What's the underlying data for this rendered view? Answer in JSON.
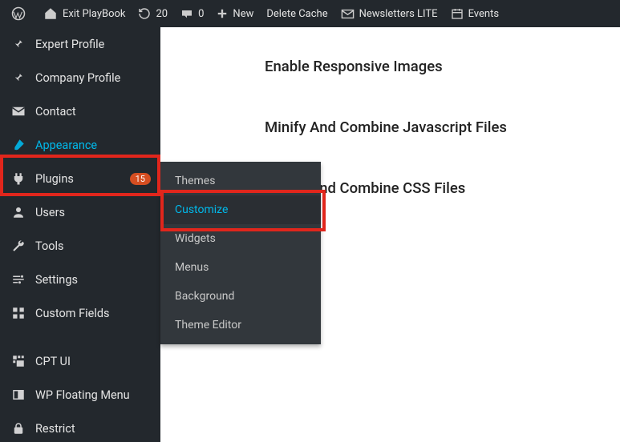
{
  "adminbar": {
    "site": "Exit PlayBook",
    "refresh": "20",
    "comments": "0",
    "new": "New",
    "delete_cache": "Delete Cache",
    "newsletters": "Newsletters LITE",
    "events": "Events",
    "plus": "+"
  },
  "sidebar": {
    "items": [
      {
        "key": "expert-profile",
        "label": "Expert Profile",
        "icon": "pin"
      },
      {
        "key": "company-profile",
        "label": "Company Profile",
        "icon": "pin"
      },
      {
        "key": "contact",
        "label": "Contact",
        "icon": "mail"
      },
      {
        "key": "appearance",
        "label": "Appearance",
        "icon": "brush",
        "active": true
      },
      {
        "key": "plugins",
        "label": "Plugins",
        "icon": "plug",
        "badge": "15"
      },
      {
        "key": "users",
        "label": "Users",
        "icon": "user"
      },
      {
        "key": "tools",
        "label": "Tools",
        "icon": "wrench"
      },
      {
        "key": "settings",
        "label": "Settings",
        "icon": "sliders"
      },
      {
        "key": "custom-fields",
        "label": "Custom Fields",
        "icon": "grid"
      },
      {
        "key": "cpt-ui",
        "label": "CPT UI",
        "icon": "tiles",
        "group": true
      },
      {
        "key": "wp-floating",
        "label": "WP Floating Menu",
        "icon": "panel"
      },
      {
        "key": "restrict",
        "label": "Restrict",
        "icon": "lock"
      }
    ]
  },
  "submenu": {
    "items": [
      {
        "label": "Themes"
      },
      {
        "label": "Customize",
        "selected": true
      },
      {
        "label": "Widgets"
      },
      {
        "label": "Menus"
      },
      {
        "label": "Background"
      },
      {
        "label": "Theme Editor"
      }
    ]
  },
  "content": {
    "rows": [
      "Enable Responsive Images",
      "Minify And Combine Javascript Files",
      "Minify And Combine CSS Files"
    ]
  }
}
